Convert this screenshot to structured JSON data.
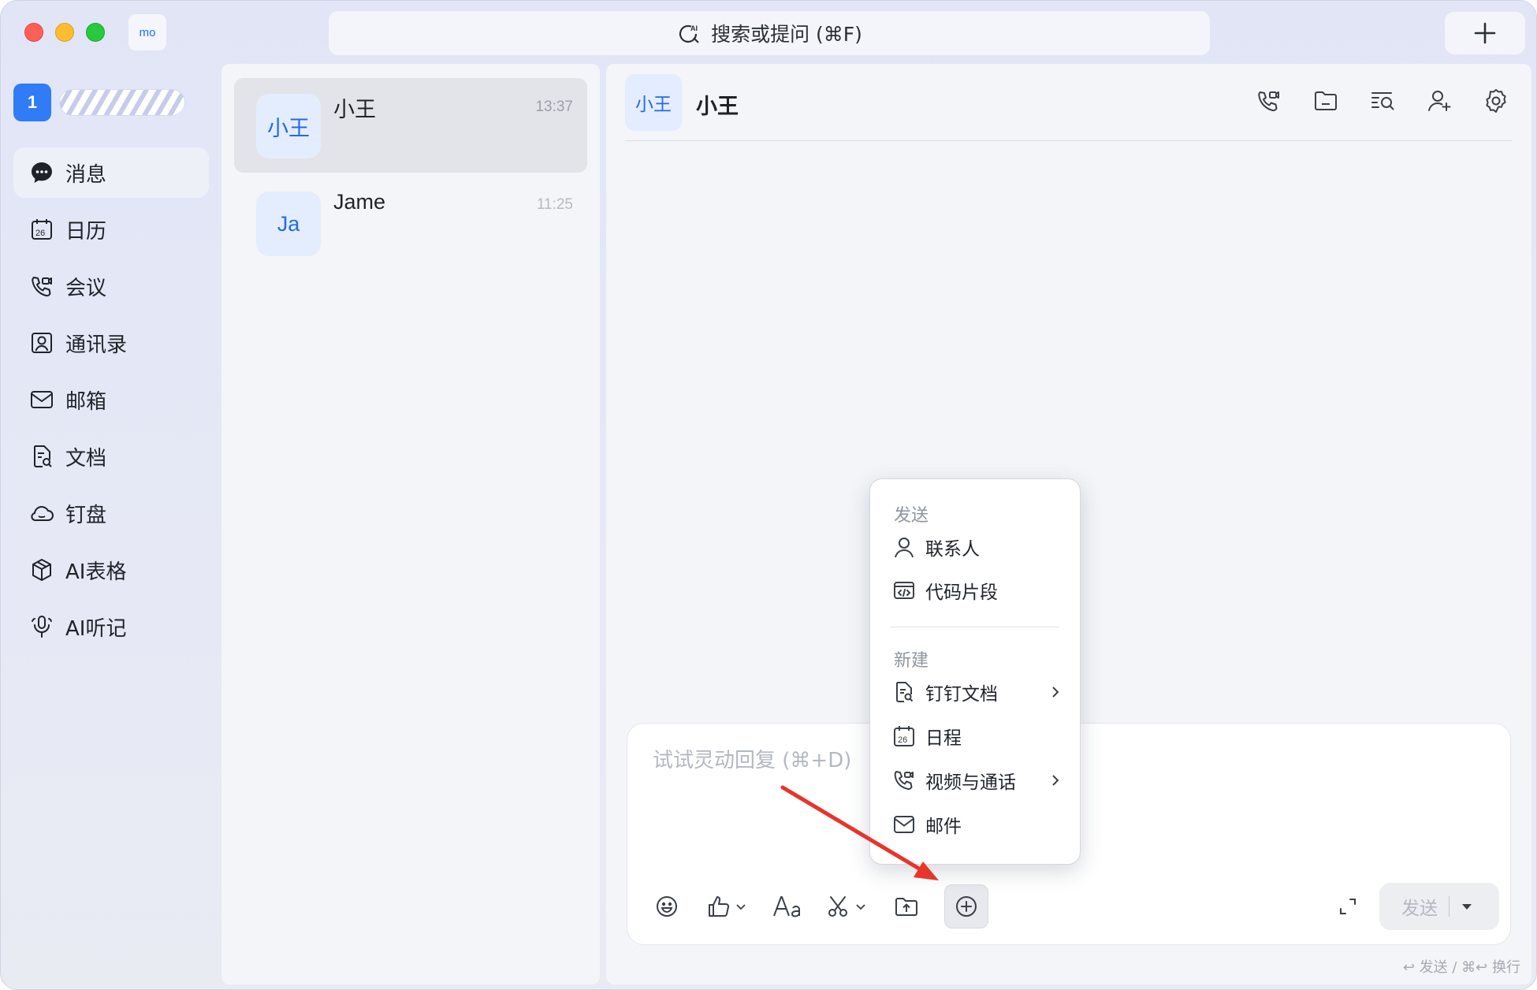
{
  "titlebar": {
    "org_chip": "mo",
    "search_label": "搜索或提问 (⌘F)"
  },
  "account": {
    "badge": "1"
  },
  "nav": {
    "items": [
      {
        "label": "消息",
        "icon": "chat-bubble-icon",
        "active": true
      },
      {
        "label": "日历",
        "icon": "calendar-icon"
      },
      {
        "label": "会议",
        "icon": "phone-video-icon"
      },
      {
        "label": "通讯录",
        "icon": "contacts-icon"
      },
      {
        "label": "邮箱",
        "icon": "mail-icon"
      },
      {
        "label": "文档",
        "icon": "document-icon"
      },
      {
        "label": "钉盘",
        "icon": "cloud-icon"
      },
      {
        "label": "AI表格",
        "icon": "cube-icon"
      },
      {
        "label": "AI听记",
        "icon": "mic-icon"
      }
    ]
  },
  "conversations": [
    {
      "avatar": "小王",
      "name": "小王",
      "time": "13:37",
      "selected": true
    },
    {
      "avatar": "Ja",
      "name": "Jame",
      "time": "11:25",
      "selected": false
    }
  ],
  "chat": {
    "avatar": "小王",
    "title": "小王",
    "header_icons": [
      "call-icon",
      "folder-icon",
      "search-list-icon",
      "add-member-icon",
      "settings-icon"
    ],
    "composer_placeholder": "试试灵动回复 (⌘+D)",
    "send_label": "发送",
    "hint": "↩ 发送 / ⌘↩ 换行"
  },
  "menu": {
    "section_send": "发送",
    "send_items": [
      {
        "label": "联系人",
        "icon": "person-icon"
      },
      {
        "label": "代码片段",
        "icon": "code-snippet-icon"
      }
    ],
    "section_new": "新建",
    "new_items": [
      {
        "label": "钉钉文档",
        "icon": "document-icon",
        "submenu": true
      },
      {
        "label": "日程",
        "icon": "calendar-icon",
        "submenu": false
      },
      {
        "label": "视频与通话",
        "icon": "phone-video-icon",
        "submenu": true
      },
      {
        "label": "邮件",
        "icon": "mail-icon",
        "submenu": false
      }
    ]
  },
  "colors": {
    "accent": "#2f7cf6",
    "annotation_arrow": "#e8342b"
  }
}
